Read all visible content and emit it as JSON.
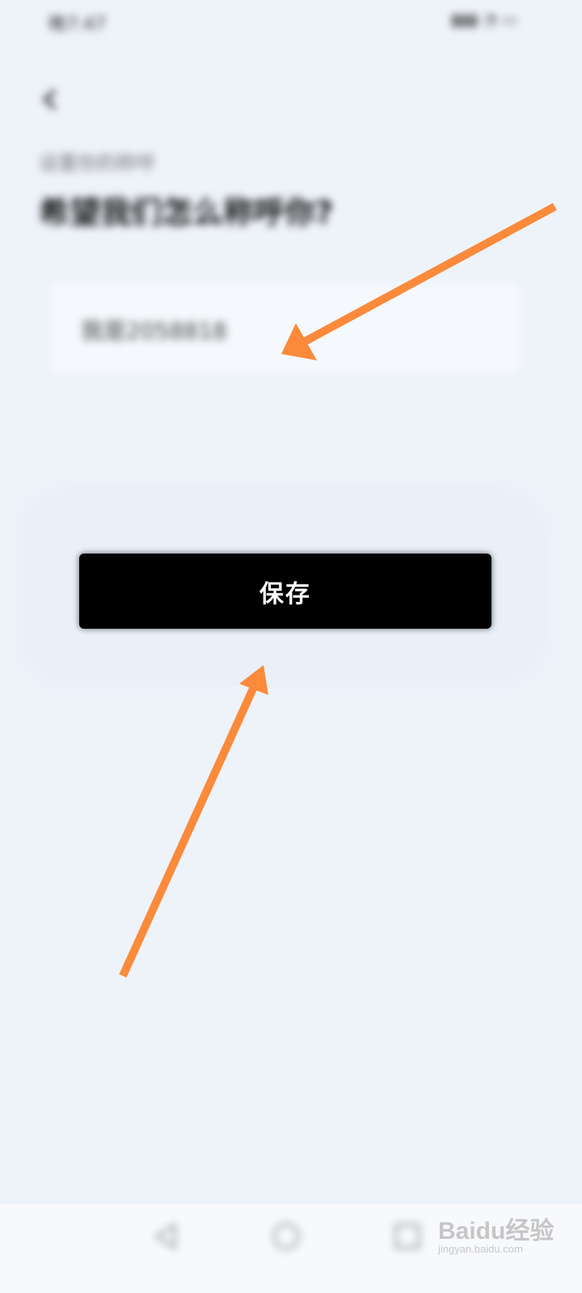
{
  "status_bar": {
    "left_text": "晚7:47 ",
    "right_text": ""
  },
  "header": {
    "back_icon": "back-arrow-icon",
    "subtitle": "设置你的称呼",
    "title": "希望我们怎么称呼你?"
  },
  "input": {
    "value": "我是2058818"
  },
  "actions": {
    "save_label": "保存"
  },
  "nav_bar": {
    "icons": [
      "back-triangle-icon",
      "home-circle-icon",
      "recents-square-icon"
    ]
  },
  "watermark": {
    "logo": "Baidu经验",
    "sub": "jingyan.baidu.com"
  },
  "colors": {
    "accent_arrow": "#fb8a3b",
    "button_bg": "#000000",
    "page_bg": "#eef3fa"
  }
}
